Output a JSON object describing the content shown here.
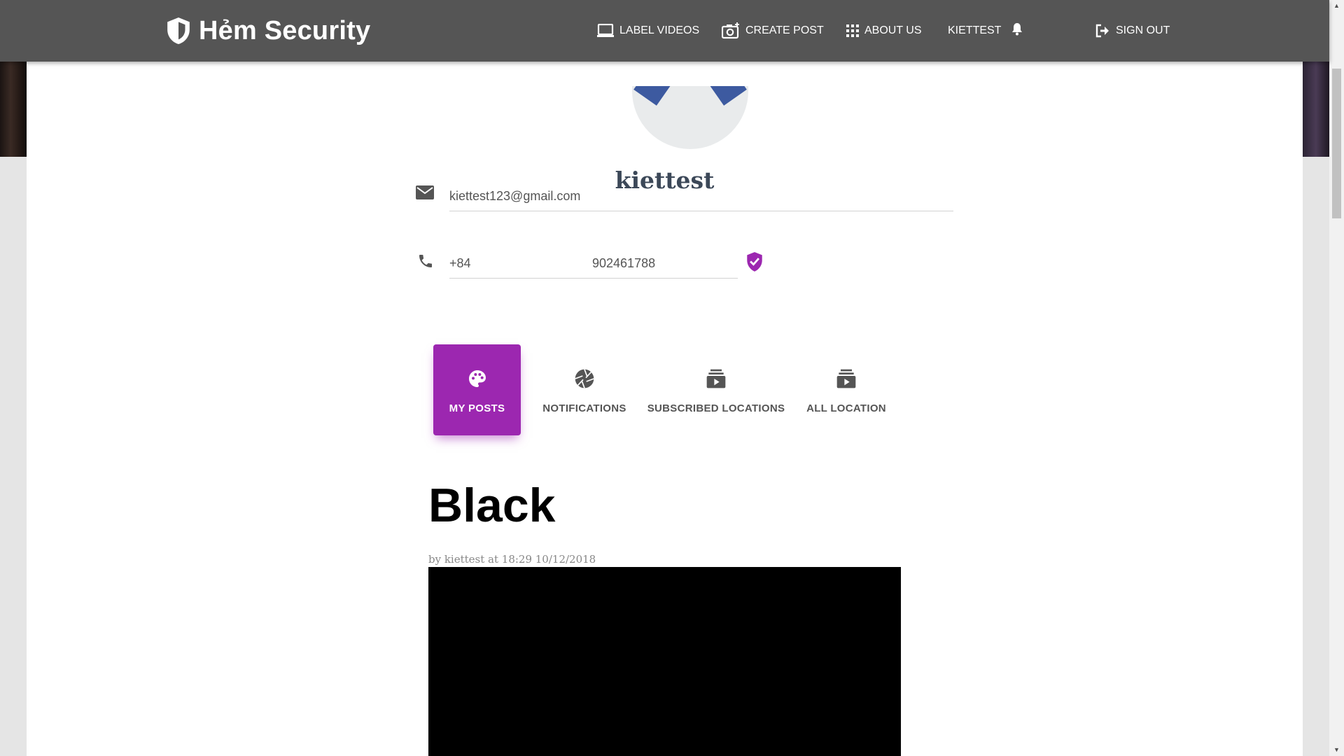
{
  "navbar": {
    "brand": "Hẻm Security",
    "items": [
      {
        "label": "LABEL VIDEOS",
        "icon": "laptop-icon"
      },
      {
        "label": "CREATE POST",
        "icon": "camera-add-icon"
      },
      {
        "label": "ABOUT US",
        "icon": "grid-icon"
      },
      {
        "label": "KIETTEST",
        "icon": "bell-icon"
      },
      {
        "label": "SIGN OUT",
        "icon": "sign-out-icon"
      }
    ]
  },
  "profile": {
    "username": "kiettest",
    "email": "kiettest123@gmail.com",
    "phone_code": "+84",
    "phone_number": "902461788"
  },
  "tabs": [
    {
      "label": "MY POSTS",
      "icon": "palette-icon",
      "active": true
    },
    {
      "label": "NOTIFICATIONS",
      "icon": "camera-shutter-icon",
      "active": false
    },
    {
      "label": "SUBSCRIBED LOCATIONS",
      "icon": "subscriptions-icon",
      "active": false
    },
    {
      "label": "ALL LOCATION",
      "icon": "subscriptions-icon",
      "active": false
    }
  ],
  "post": {
    "title": "Black",
    "meta": "by kiettest at 18:29 10/12/2018"
  },
  "colors": {
    "navbar": "#555555",
    "accent": "#9c27b0",
    "username": "#3c4858"
  }
}
